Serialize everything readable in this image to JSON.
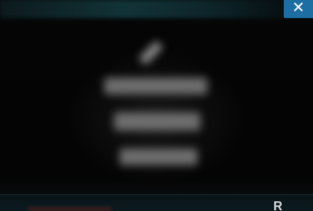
{
  "header": {
    "close_label": "✕"
  },
  "dialog": {
    "edit_icon": "pencil-icon",
    "lines": [
      "",
      "",
      ""
    ]
  },
  "bottom_bar": {
    "letter": "R"
  },
  "colors": {
    "close_button": "#1d6fa3",
    "background": "#050505"
  }
}
